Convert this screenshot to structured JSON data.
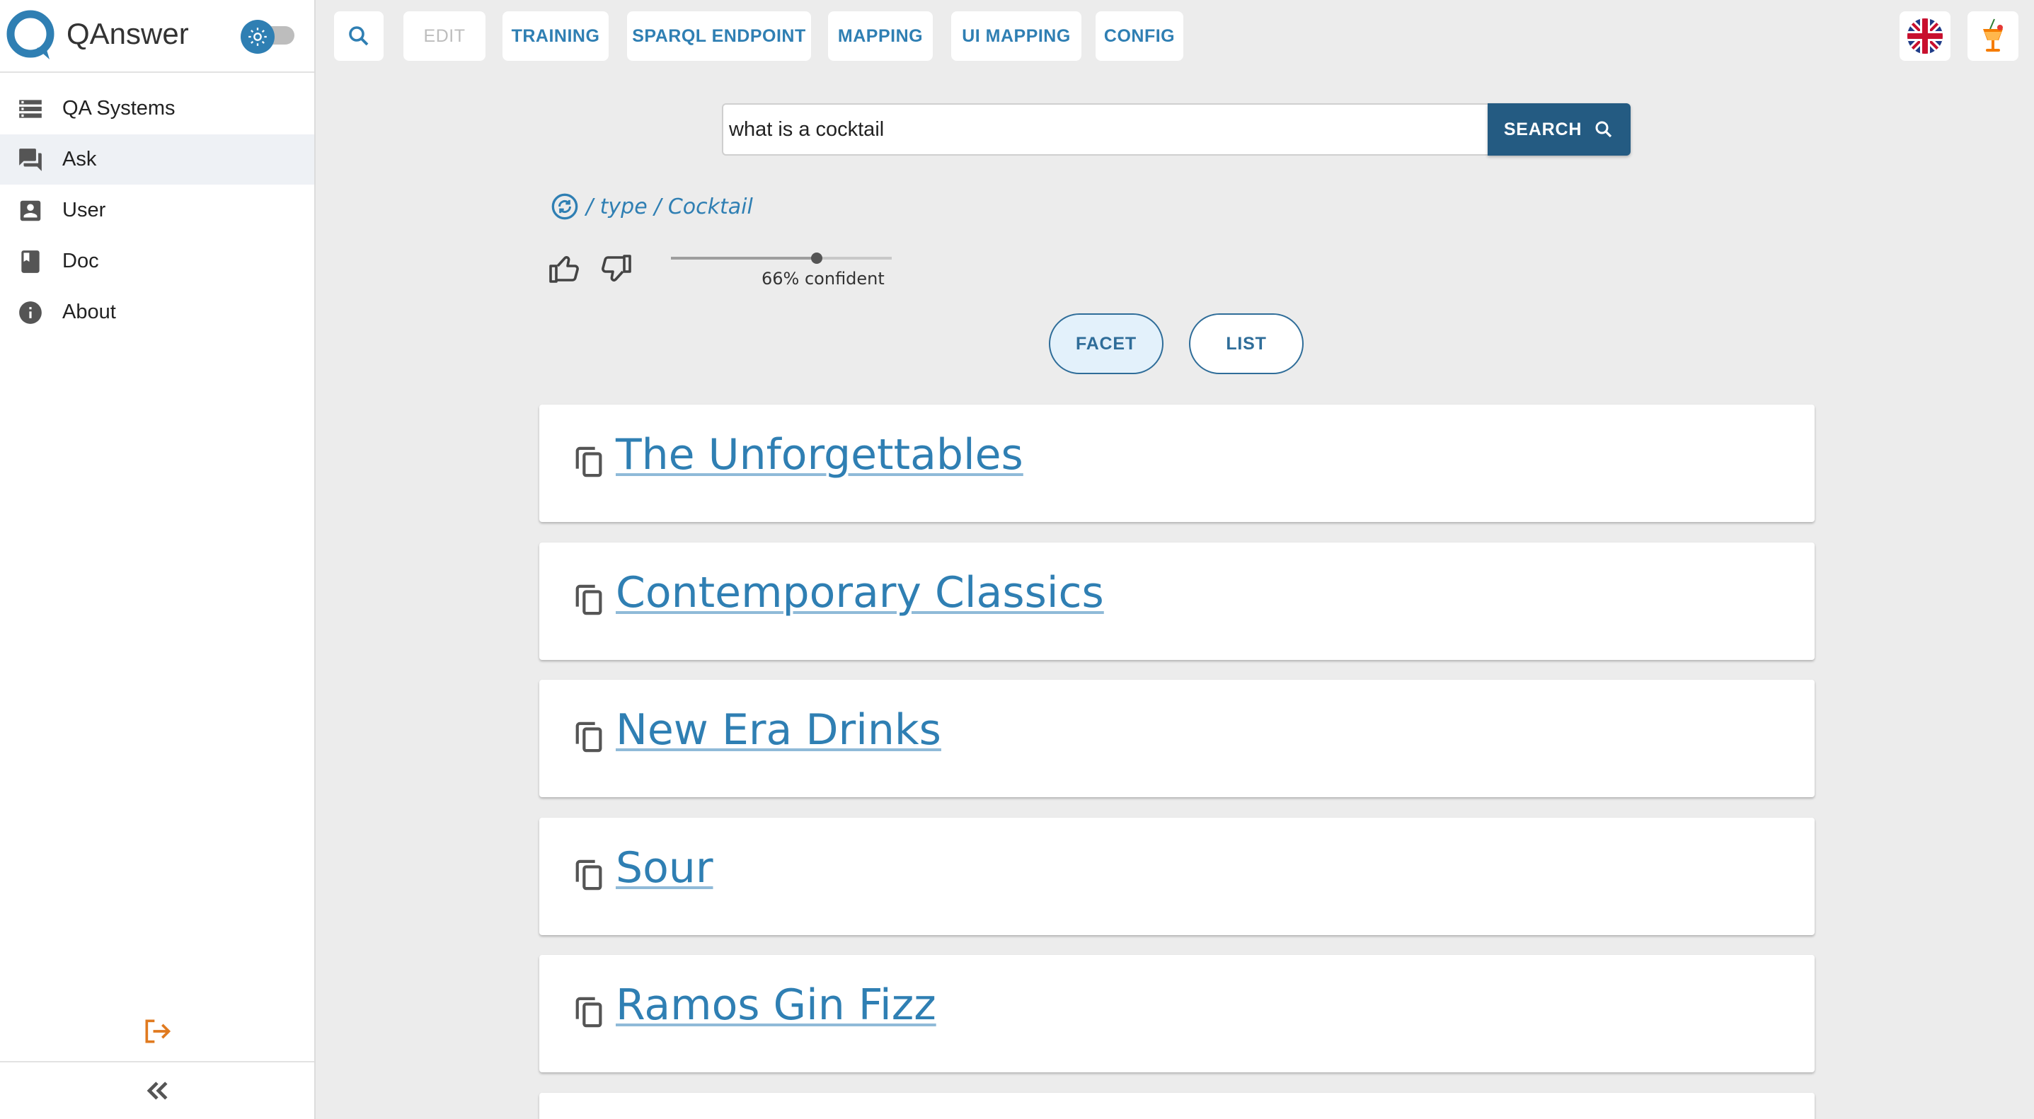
{
  "app": {
    "name": "QAnswer"
  },
  "sidebar": {
    "items": [
      {
        "label": "QA Systems",
        "icon": "storage-icon"
      },
      {
        "label": "Ask",
        "icon": "forum-icon"
      },
      {
        "label": "User",
        "icon": "account-box-icon"
      },
      {
        "label": "Doc",
        "icon": "book-icon"
      },
      {
        "label": "About",
        "icon": "info-icon"
      }
    ]
  },
  "topbar": {
    "edit": "EDIT",
    "training": "TRAINING",
    "sparql": "SPARQL ENDPOINT",
    "mapping": "MAPPING",
    "ui_mapping": "UI MAPPING",
    "config": "CONFIG"
  },
  "search": {
    "value": "what is a cocktail",
    "button_label": "SEARCH"
  },
  "breadcrumb": {
    "text": "/ type / Cocktail"
  },
  "feedback": {
    "confidence_label": "66% confident",
    "confidence": 0.66
  },
  "view": {
    "facet_label": "FACET",
    "list_label": "LIST"
  },
  "results": [
    "The Unforgettables",
    "Contemporary Classics",
    "New Era Drinks",
    "Sour",
    "Ramos Gin Fizz"
  ],
  "colors": {
    "accent": "#2f7fb3",
    "search_button": "#245b82",
    "logout": "#e07a1f"
  }
}
